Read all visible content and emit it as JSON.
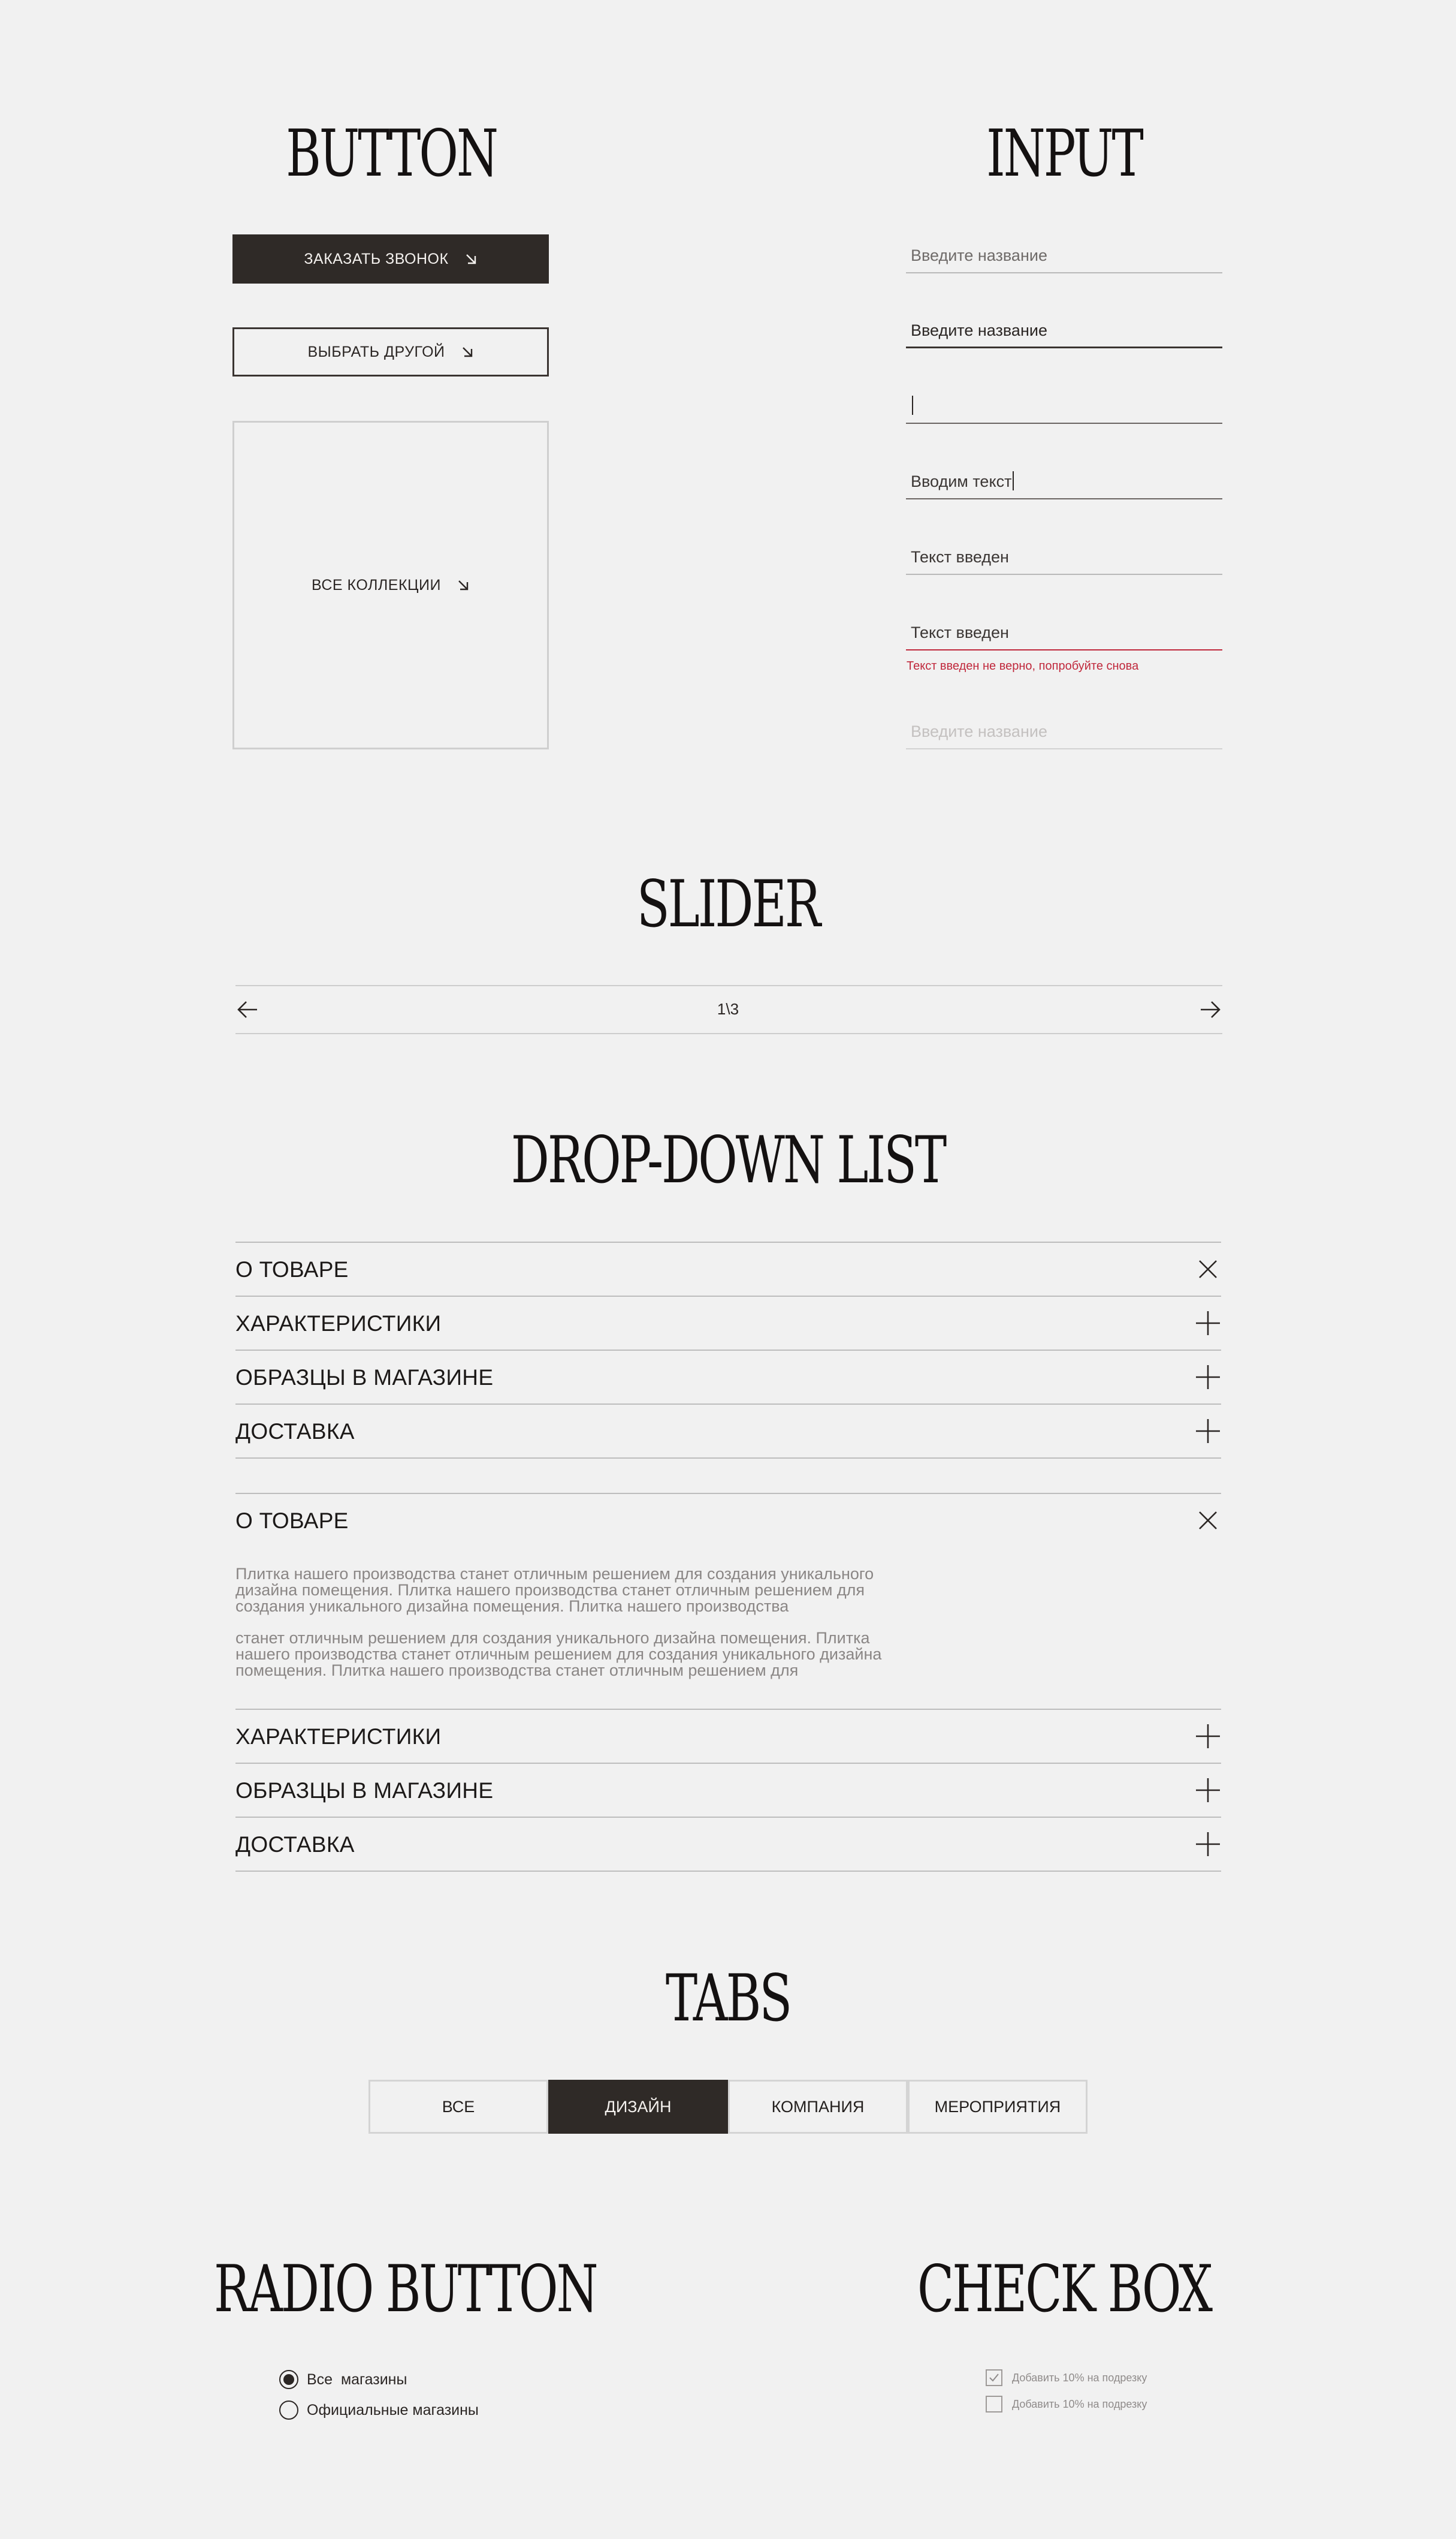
{
  "sections": {
    "button": "Button",
    "input": "Input",
    "slider": "Slider",
    "dropdown": "Drop-down list",
    "tabs": "Tabs",
    "radio": "Radio button",
    "checkbox": "Check box"
  },
  "buttons": {
    "primary": "ЗАКАЗАТЬ ЗВОНОК",
    "secondary": "ВЫБРАТЬ ДРУГОЙ",
    "tertiary": "ВСЕ КОЛЛЕКЦИИ",
    "arrow_icon": "arrow-down-right-icon"
  },
  "inputs": {
    "default_placeholder": "Введите название",
    "hover_placeholder": "Введите название",
    "focus_value": "",
    "typing_value": "Вводим текст",
    "filled_value": "Текст введен",
    "error_value": "Текст введен",
    "error_message": "Текст введен не верно, попробуйте снова",
    "disabled_placeholder": "Введите название",
    "error_color": "#c0283c"
  },
  "slider": {
    "counter": "1\\3",
    "prev_icon": "arrow-left-icon",
    "next_icon": "arrow-right-icon"
  },
  "accordion_closed": {
    "items": [
      {
        "label": "О ТОВАРЕ",
        "icon": "close-icon"
      },
      {
        "label": "ХАРАКТЕРИСТИКИ",
        "icon": "plus-icon"
      },
      {
        "label": "ОБРАЗЦЫ В МАГАЗИНЕ",
        "icon": "plus-icon"
      },
      {
        "label": "ДОСТАВКА",
        "icon": "plus-icon"
      }
    ]
  },
  "accordion_open": {
    "items": [
      {
        "label": "О ТОВАРЕ",
        "icon": "close-icon"
      },
      {
        "label": "ХАРАКТЕРИСТИКИ",
        "icon": "plus-icon"
      },
      {
        "label": "ОБРАЗЦЫ В МАГАЗИНЕ",
        "icon": "plus-icon"
      },
      {
        "label": "ДОСТАВКА",
        "icon": "plus-icon"
      }
    ],
    "body_paragraph_1": "Плитка нашего производства станет отличным решением для создания уникального дизайна помещения. Плитка нашего производства станет отличным решением для создания уникального дизайна помещения. Плитка нашего производства",
    "body_paragraph_2": "станет отличным решением для создания уникального дизайна помещения. Плитка нашего производства станет отличным решением для создания уникального дизайна помещения. Плитка нашего производства станет отличным решением для"
  },
  "tabs": [
    {
      "label": "ВСЕ",
      "active": false
    },
    {
      "label": "ДИЗАЙН",
      "active": true
    },
    {
      "label": "КОМПАНИЯ",
      "active": false
    },
    {
      "label": "МЕРОПРИЯТИЯ",
      "active": false
    }
  ],
  "radio": [
    {
      "label": "Все  магазины",
      "selected": true
    },
    {
      "label": "Официальные магазины",
      "selected": false
    }
  ],
  "checkbox": [
    {
      "label": "Добавить 10% на подрезку",
      "checked": true
    },
    {
      "label": "Добавить 10% на подрезку",
      "checked": false
    }
  ],
  "colors": {
    "background": "#f1f1f1",
    "dark": "#2f2a27",
    "error": "#c0283c",
    "muted_text": "#8a8685"
  }
}
